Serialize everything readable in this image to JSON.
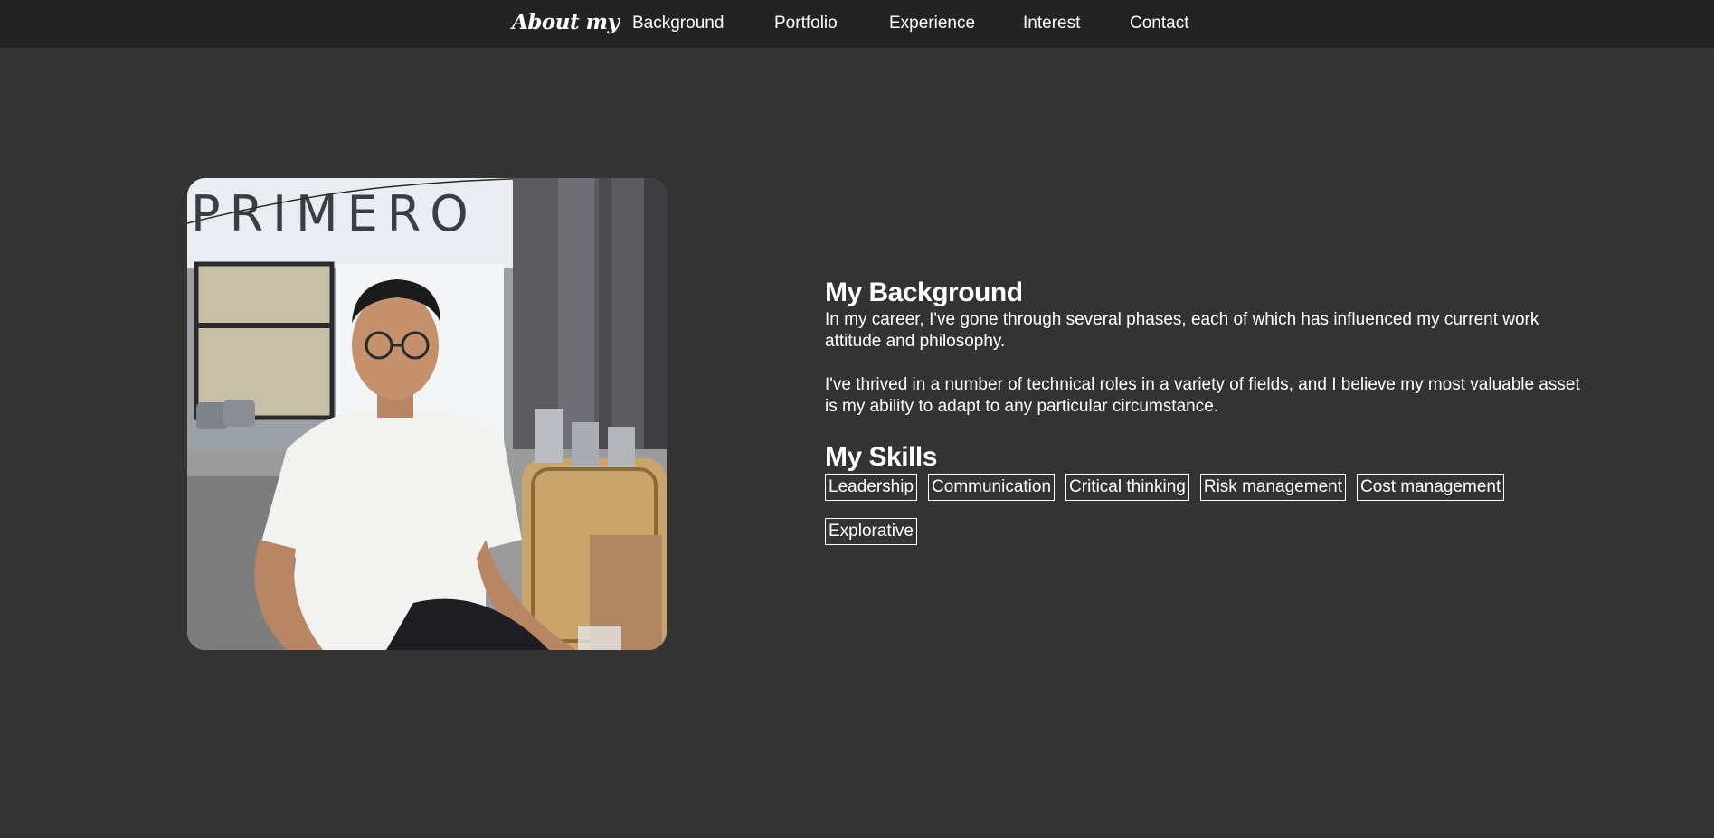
{
  "nav": {
    "brand": "About my",
    "links": [
      "Background",
      "Portfolio",
      "Experience",
      "Interest",
      "Contact"
    ]
  },
  "photo": {
    "sign_text": "PRIMERO"
  },
  "background": {
    "title": "My Background",
    "paragraph1": "In my career, I've gone through several phases, each of which has influenced my current work attitude and philosophy.",
    "paragraph2": "I've thrived in a number of technical roles in a variety of fields, and I believe my most valuable asset is my ability to adapt to any particular circumstance."
  },
  "skills": {
    "title": "My Skills",
    "items": [
      "Leadership",
      "Communication",
      "Critical thinking",
      "Risk management",
      "Cost management",
      "Explorative"
    ]
  },
  "colors": {
    "page_bg": "#333333",
    "nav_bg": "#232323",
    "text": "#ffffff"
  }
}
